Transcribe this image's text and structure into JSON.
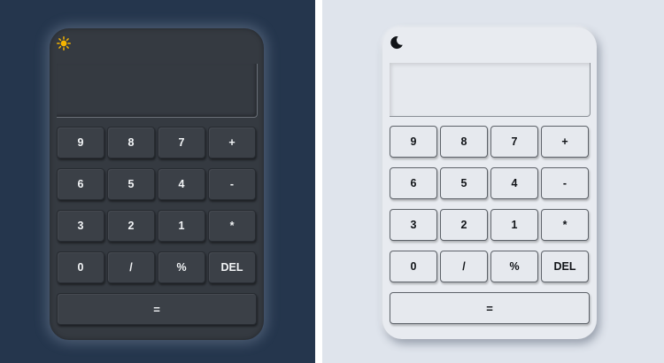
{
  "dark_calculator": {
    "mode_icon": "sun-icon",
    "display_value": "",
    "colors": {
      "page_bg": "#25364d",
      "body_bg": "#353a41",
      "icon": "#f5b400"
    }
  },
  "light_calculator": {
    "mode_icon": "moon-icon",
    "display_value": "",
    "colors": {
      "page_bg": "#dfe4ec",
      "body_bg": "#e8ebf0",
      "icon": "#111418"
    }
  },
  "keys": {
    "row1": [
      "9",
      "8",
      "7",
      "+"
    ],
    "row2": [
      "6",
      "5",
      "4",
      "-"
    ],
    "row3": [
      "3",
      "2",
      "1",
      "*"
    ],
    "row4": [
      "0",
      "/",
      "%",
      "DEL"
    ],
    "equals": "="
  }
}
